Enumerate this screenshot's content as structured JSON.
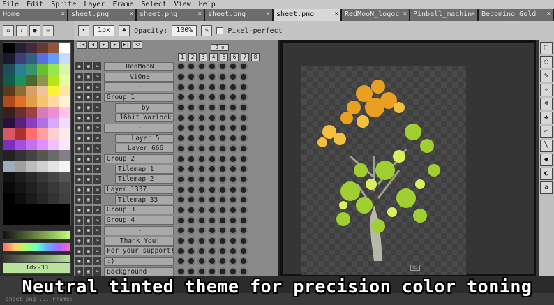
{
  "menu": [
    "File",
    "Edit",
    "Sprite",
    "Layer",
    "Frame",
    "Select",
    "View",
    "Help"
  ],
  "tabs": [
    {
      "label": "Home",
      "active": false
    },
    {
      "label": "sheet.png",
      "active": false
    },
    {
      "label": "sheet.png",
      "active": false
    },
    {
      "label": "sheet.png",
      "active": false
    },
    {
      "label": "sheet.png",
      "active": true
    },
    {
      "label": "RedMooN_logoc",
      "active": false
    },
    {
      "label": "Pinball_machin",
      "active": false
    },
    {
      "label": "Becoming Gold",
      "active": false
    }
  ],
  "context_bar": {
    "brush_size": "1px",
    "opacity_label": "Opacity:",
    "opacity_value": "100%",
    "pixel_perfect_label": "Pixel-perfect"
  },
  "timeline": {
    "tag": "O_o",
    "frames": [
      "1",
      "2",
      "3",
      "4",
      "5",
      "6",
      "7",
      "8"
    ],
    "layers": [
      "RedMooN",
      "ViOne",
      "-",
      "Group 1",
      "by",
      "16bit Warlock",
      "-",
      "Layer 5",
      "Layer 666",
      "Group 2",
      "Tilemap 1",
      "Tilemap 2",
      "Layer 1337",
      "Tilemap 33",
      "Group 3",
      "Group 4",
      "-",
      "Thank You!",
      "For your support!",
      ":)",
      "Background"
    ]
  },
  "palette": {
    "index_label": "Idx-33",
    "colors": [
      "#000000",
      "#222034",
      "#45283c",
      "#663931",
      "#8f563b",
      "#ffffff",
      "#1a1a2e",
      "#3f3f74",
      "#306082",
      "#5b6ee1",
      "#639bff",
      "#cbdbfc",
      "#1b4f5c",
      "#2a7f92",
      "#37946e",
      "#6abe30",
      "#99e550",
      "#d9f5a8",
      "#0e5d4a",
      "#1f8f5f",
      "#4b692f",
      "#8f974a",
      "#b5e61d",
      "#e6ff9e",
      "#5a3a1a",
      "#8a6f30",
      "#d9a066",
      "#eec39a",
      "#fbf236",
      "#ffe4a8",
      "#b04a1a",
      "#df7126",
      "#e09f4a",
      "#f2c572",
      "#ffd7a0",
      "#fff1d6",
      "#3a1e1e",
      "#6a2f2f",
      "#a04040",
      "#d77bba",
      "#ef8fd0",
      "#ffc6e6",
      "#2a1040",
      "#5a2080",
      "#8a3fc0",
      "#b070e0",
      "#d8a8ff",
      "#f0dcff",
      "#d95763",
      "#ac3232",
      "#ff6e6e",
      "#ff9f9f",
      "#ffcfcf",
      "#ffeaea",
      "#7b2fbe",
      "#a44fe0",
      "#c46ff0",
      "#e08fff",
      "#f0c0ff",
      "#fbe8ff",
      "#222222",
      "#333333",
      "#444444",
      "#595652",
      "#696a6a",
      "#847e87",
      "#9badb7",
      "#a0a0a0",
      "#bcbcbc",
      "#d0d0d0",
      "#e4e4e4",
      "#f4f4f4",
      "#111111",
      "#1d1d1d",
      "#2a2a2a",
      "#383838",
      "#464646",
      "#545454",
      "#090909",
      "#151515",
      "#202020",
      "#2c2c2c",
      "#383838",
      "#444444",
      "#000000",
      "#0d0d0d",
      "#1a1a1a",
      "#262626",
      "#333333",
      "#404040",
      "#000000",
      "#000000",
      "#000000",
      "#000000",
      "#000000",
      "#000000",
      "#000000",
      "#000000",
      "#000000",
      "#000000",
      "#000000",
      "#000000"
    ]
  },
  "caption": "Neutral tinted theme for precision color toning",
  "status_text": "sheet.png ... Frame:"
}
